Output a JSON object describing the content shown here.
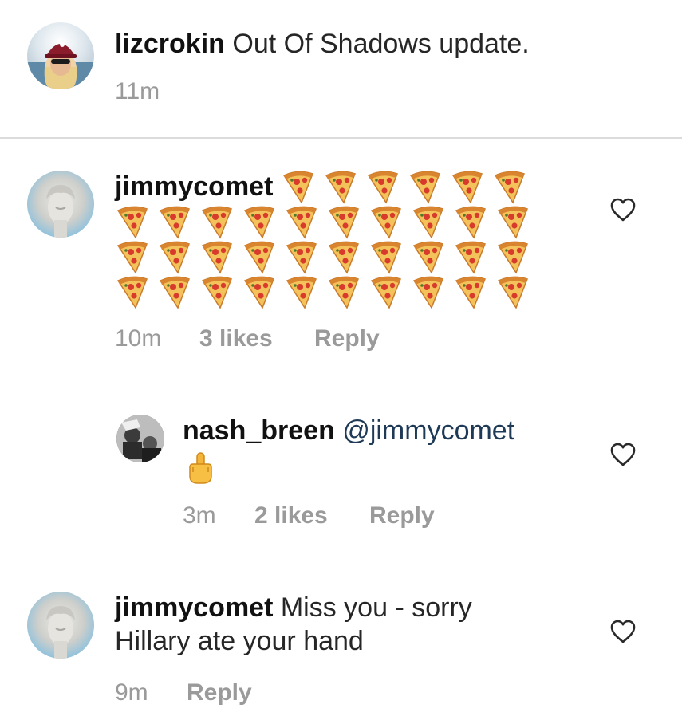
{
  "post": {
    "username": "lizcrokin",
    "caption": "Out Of Shadows update.",
    "time": "11m"
  },
  "comments": [
    {
      "username": "jimmycomet",
      "emoji_rows": 4,
      "time": "10m",
      "likes": "3 likes",
      "reply": "Reply"
    },
    {
      "username": "nash_breen",
      "mention": "@jimmycomet",
      "emoji": "middle-finger-emoji",
      "time": "3m",
      "likes": "2 likes",
      "reply": "Reply"
    },
    {
      "username": "jimmycomet",
      "text_line1": "Miss you - sorry",
      "text_line2": "Hillary ate your hand",
      "time": "9m",
      "reply": "Reply"
    }
  ],
  "icons": {
    "heart": "heart-outline-icon",
    "pizza": "pizza-slice-emoji"
  }
}
